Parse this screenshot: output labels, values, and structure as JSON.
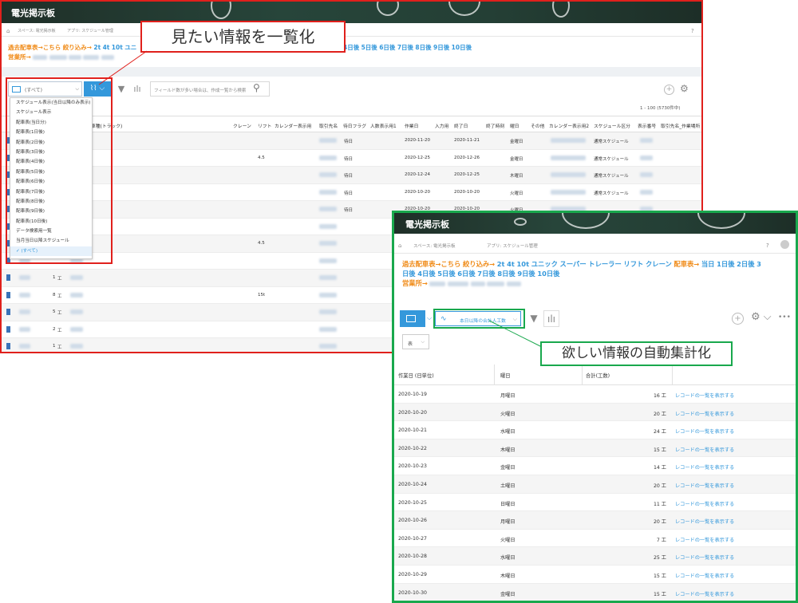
{
  "left_window": {
    "app_title": "電光掲示板",
    "breadcrumb": [
      "スペース: 電光掲示板",
      "アプリ: スケジュール管理"
    ],
    "links_line1_prefix": "過去配車表→こちら",
    "links_line1_filter": "絞り込み→",
    "links_line1_items": [
      "2t",
      "4t",
      "10t",
      "ユニ"
    ],
    "links_line1_right": [
      "4日後",
      "5日後",
      "6日後",
      "7日後",
      "8日後",
      "9日後",
      "10日後"
    ],
    "links_line2_prefix": "営業所→",
    "view_select_label": "(すべて)",
    "search_placeholder": "フィールド数が多い場合は、作成一覧から検索",
    "record_count": "1 - 100 (5730件中)",
    "table_headers": [
      "車種(トラック)",
      "クレーン",
      "リフト",
      "カレンダー表示用",
      "取引先名",
      "待日フラグ",
      "人数表示用1",
      "作業日",
      "入力用",
      "終了日",
      "終了時刻",
      "曜日",
      "その他",
      "カレンダー表示用2",
      "スケジュール区分",
      "表示番号",
      "取引先名_作業場所"
    ],
    "rows": [
      {
        "lift": "",
        "flag": "待日",
        "date": "2020-11-20",
        "end": "2020-11-21",
        "dow": "金曜日",
        "kind": "通常スケジュール",
        "n": "",
        "ton": ""
      },
      {
        "lift": "4.5",
        "flag": "待日",
        "date": "2020-12-25",
        "end": "2020-12-26",
        "dow": "金曜日",
        "kind": "通常スケジュール",
        "n": "",
        "ton": ""
      },
      {
        "lift": "",
        "flag": "待日",
        "date": "2020-12-24",
        "end": "2020-12-25",
        "dow": "木曜日",
        "kind": "通常スケジュール",
        "n": "",
        "ton": ""
      },
      {
        "lift": "",
        "flag": "待日",
        "date": "2020-10-20",
        "end": "2020-10-20",
        "dow": "火曜日",
        "kind": "通常スケジュール",
        "n": "",
        "ton": ""
      },
      {
        "lift": "",
        "flag": "待日",
        "date": "2020-10-20",
        "end": "2020-10-20",
        "dow": "火曜日",
        "kind": "",
        "n": "",
        "ton": ""
      },
      {
        "lift": "",
        "flag": "",
        "date": "",
        "end": "",
        "dow": "",
        "kind": "",
        "n": "",
        "ton": ""
      },
      {
        "lift": "4.5",
        "flag": "",
        "date": "",
        "end": "",
        "dow": "",
        "kind": "",
        "n": "",
        "ton": ""
      },
      {
        "lift": "",
        "flag": "",
        "date": "",
        "end": "",
        "dow": "",
        "kind": "",
        "n": "",
        "ton": ""
      },
      {
        "lift": "",
        "flag": "",
        "date": "",
        "end": "",
        "dow": "",
        "kind": "",
        "n": "1",
        "ton": "工"
      },
      {
        "lift": "15t",
        "flag": "",
        "date": "",
        "end": "",
        "dow": "",
        "kind": "",
        "n": "8",
        "ton": "工"
      },
      {
        "lift": "",
        "flag": "",
        "date": "",
        "end": "",
        "dow": "",
        "kind": "",
        "n": "5",
        "ton": "工"
      },
      {
        "lift": "",
        "flag": "",
        "date": "",
        "end": "",
        "dow": "",
        "kind": "",
        "n": "2",
        "ton": "工"
      },
      {
        "lift": "",
        "flag": "",
        "date": "",
        "end": "",
        "dow": "",
        "kind": "",
        "n": "1",
        "ton": "工"
      }
    ],
    "dropdown_items": [
      "スケジュール表示(当日以降のみ表示)",
      "スケジュール表示",
      "配車表(当日分)",
      "配車表(1日後)",
      "配車表(2日後)",
      "配車表(3日後)",
      "配車表(4日後)",
      "配車表(5日後)",
      "配車表(6日後)",
      "配車表(7日後)",
      "配車表(8日後)",
      "配車表(9日後)",
      "配車表(10日後)",
      "データ検索用一覧",
      "当月当日以降スケジュール",
      "(すべて)"
    ],
    "dropdown_selected": "(すべて)"
  },
  "callout_red": "見たい情報を一覧化",
  "callout_green": "欲しい情報の自動集計化",
  "right_window": {
    "app_title": "電光掲示板",
    "breadcrumb": [
      "スペース: 電光掲示板",
      "アプリ: スケジュール管理"
    ],
    "links_line1": {
      "past": "過去配車表→こちら",
      "filter": "絞り込み→",
      "items": [
        "2t",
        "4t",
        "10t",
        "ユニック",
        "スーパー",
        "トレーラー",
        "リフト",
        "クレーン"
      ],
      "sched": "配車表→",
      "days": [
        "当日",
        "1日後",
        "2日後",
        "3"
      ]
    },
    "links_line2": [
      "日後",
      "4日後",
      "5日後",
      "6日後",
      "7日後",
      "8日後",
      "9日後",
      "10日後"
    ],
    "links_line3_prefix": "営業所→",
    "graph_select": "本日以降の合計人工数",
    "table_type": "表",
    "col_headers": [
      "作業日 (日単位)",
      "曜日",
      "合計(工数)"
    ],
    "rows": [
      {
        "date": "2020-10-19",
        "dow": "月曜日",
        "total": "16 工"
      },
      {
        "date": "2020-10-20",
        "dow": "火曜日",
        "total": "20 工"
      },
      {
        "date": "2020-10-21",
        "dow": "水曜日",
        "total": "24 工"
      },
      {
        "date": "2020-10-22",
        "dow": "木曜日",
        "total": "15 工"
      },
      {
        "date": "2020-10-23",
        "dow": "金曜日",
        "total": "14 工"
      },
      {
        "date": "2020-10-24",
        "dow": "土曜日",
        "total": "20 工"
      },
      {
        "date": "2020-10-25",
        "dow": "日曜日",
        "total": "11 工"
      },
      {
        "date": "2020-10-26",
        "dow": "月曜日",
        "total": "20 工"
      },
      {
        "date": "2020-10-27",
        "dow": "火曜日",
        "total": "7 工"
      },
      {
        "date": "2020-10-28",
        "dow": "水曜日",
        "total": "25 工"
      },
      {
        "date": "2020-10-29",
        "dow": "木曜日",
        "total": "15 工"
      },
      {
        "date": "2020-10-30",
        "dow": "金曜日",
        "total": "15 工"
      }
    ],
    "row_link_text": "レコードの一覧を表示する"
  },
  "colors": {
    "callout_red": "#e0201c",
    "callout_green": "#19a84d",
    "link_blue": "#3498db",
    "link_orange": "#f08c1a"
  }
}
